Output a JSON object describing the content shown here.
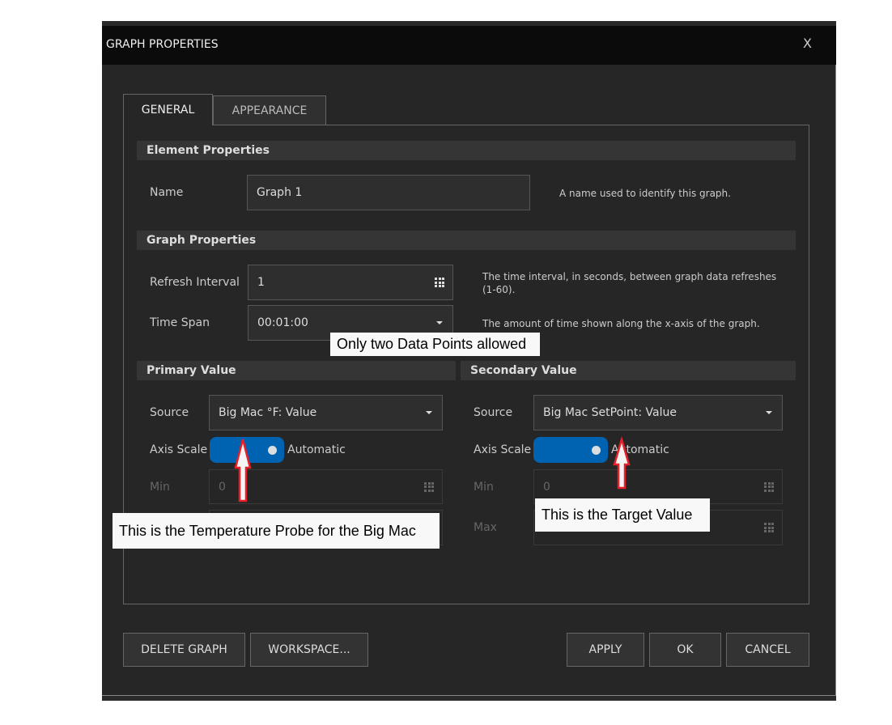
{
  "dialog": {
    "title": "GRAPH PROPERTIES",
    "close_label": "X"
  },
  "tabs": [
    {
      "label": "GENERAL",
      "active": true
    },
    {
      "label": "APPEARANCE",
      "active": false
    }
  ],
  "element_properties": {
    "header": "Element Properties",
    "name_label": "Name",
    "name_value": "Graph 1",
    "name_help": "A name used to identify this graph."
  },
  "graph_properties": {
    "header": "Graph Properties",
    "refresh_label": "Refresh Interval",
    "refresh_value": "1",
    "refresh_help_1": "The time interval, in seconds, between graph data refreshes",
    "refresh_help_2": "(1-60).",
    "timespan_label": "Time Span",
    "timespan_value": "00:01:00",
    "timespan_help": "The amount of time shown along the x-axis of the graph."
  },
  "primary": {
    "header": "Primary Value",
    "source_label": "Source",
    "source_value": "Big Mac °F: Value",
    "axis_label": "Axis Scale",
    "axis_value": "Automatic",
    "axis_on": true,
    "min_label": "Min",
    "min_value": "0"
  },
  "secondary": {
    "header": "Secondary Value",
    "source_label": "Source",
    "source_value": "Big Mac SetPoint: Value",
    "axis_label": "Axis Scale",
    "axis_value": "Automatic",
    "axis_on": true,
    "min_label": "Min",
    "min_value": "0",
    "max_label": "Max"
  },
  "annotations": {
    "data_points": "Only two Data Points allowed",
    "probe": "This is the Temperature Probe for the Big Mac",
    "target": "This is the Target Value"
  },
  "buttons": {
    "delete": "DELETE GRAPH",
    "workspace": "WORKSPACE...",
    "apply": "APPLY",
    "ok": "OK",
    "cancel": "CANCEL"
  },
  "colors": {
    "toggle_on": "#0063b1",
    "arrow_outline": "#e8202a"
  }
}
